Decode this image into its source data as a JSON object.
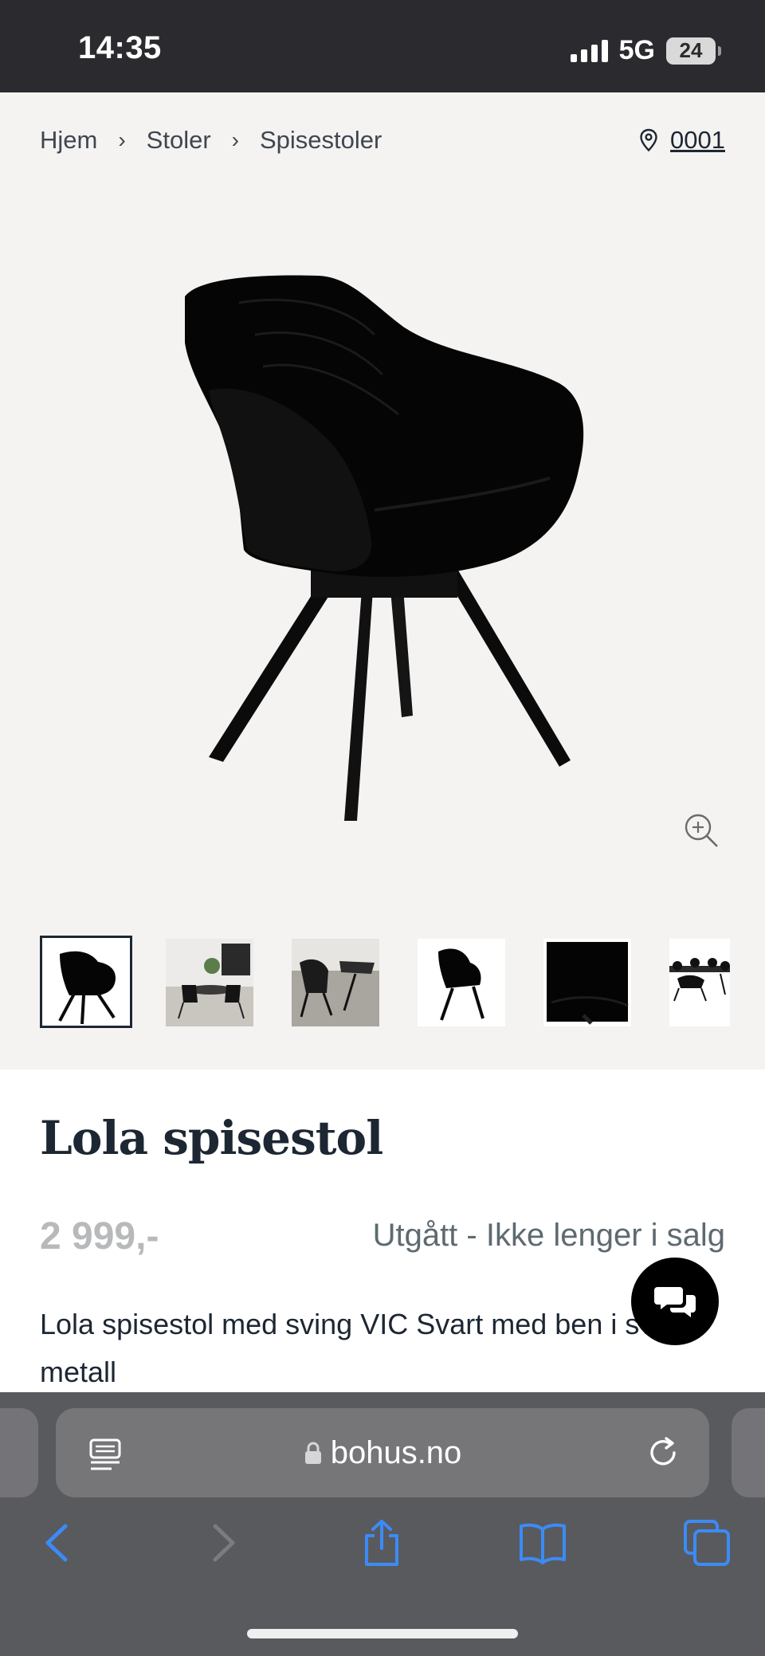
{
  "status_bar": {
    "time": "14:35",
    "network": "5G",
    "battery": "24"
  },
  "breadcrumb": {
    "items": [
      "Hjem",
      "Stoler",
      "Spisestoler"
    ],
    "separator": "›"
  },
  "store": {
    "code": "0001"
  },
  "product": {
    "title": "Lola spisestol",
    "price": "2 999,-",
    "availability": "Utgått - Ikke lenger i salg",
    "description": "Lola spisestol med sving VIC Svart med ben i svart metall"
  },
  "thumbnails": [
    {
      "name": "chair-front",
      "selected": true
    },
    {
      "name": "room-setting",
      "selected": false
    },
    {
      "name": "table-setting",
      "selected": false
    },
    {
      "name": "chair-side",
      "selected": false
    },
    {
      "name": "fabric-closeup",
      "selected": false
    },
    {
      "name": "dining-set",
      "selected": false
    }
  ],
  "browser": {
    "url": "bohus.no"
  },
  "icons": {
    "location": "location-pin-icon",
    "zoom": "zoom-in-icon",
    "chat": "chat-bubbles-icon",
    "lock": "lock-icon",
    "reader": "reader-icon",
    "reload": "reload-icon",
    "back": "chevron-left-icon",
    "forward": "chevron-right-icon",
    "share": "share-icon",
    "bookmarks": "book-icon",
    "tabs": "tabs-icon"
  },
  "colors": {
    "accent": "#1d2733",
    "safari_blue": "#3b8bf7",
    "price_grey": "#b7b9bb"
  }
}
